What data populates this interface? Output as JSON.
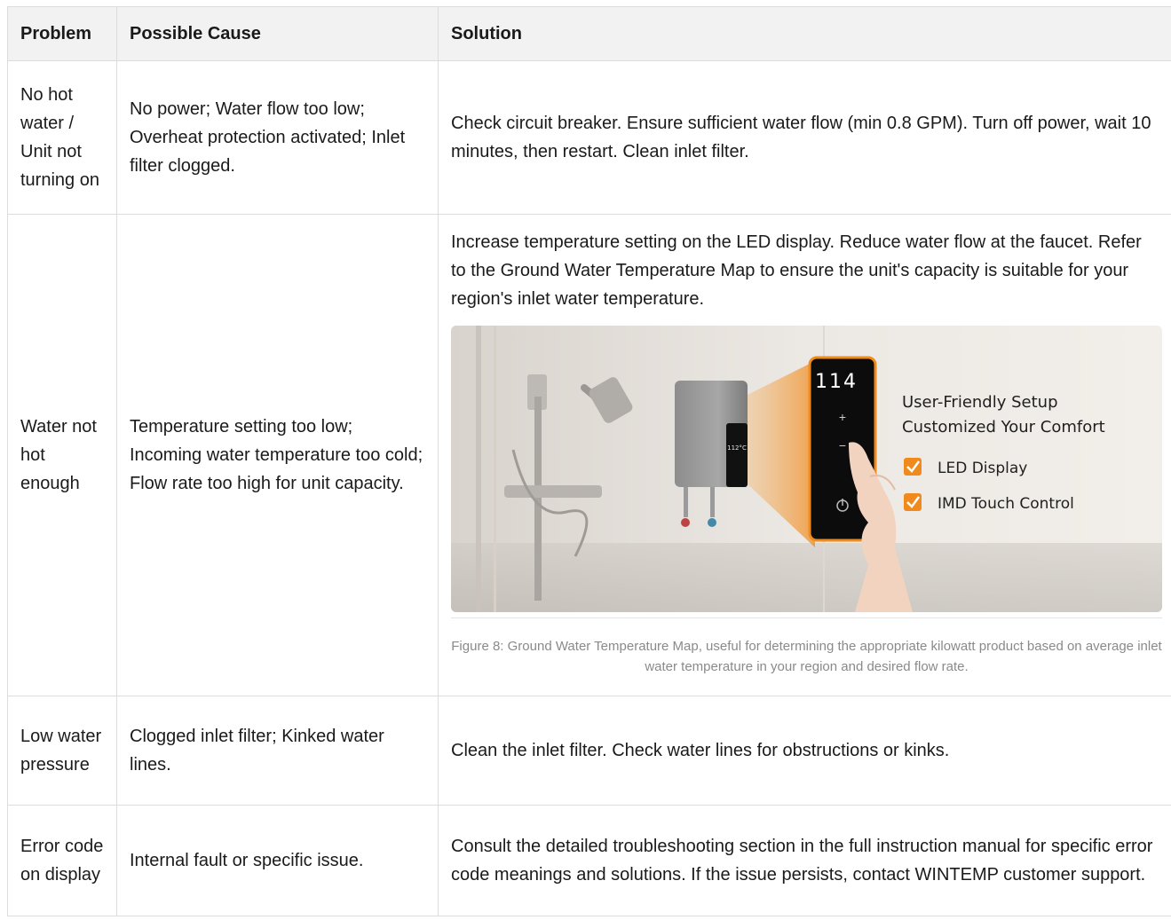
{
  "table": {
    "headers": [
      "Problem",
      "Possible Cause",
      "Solution"
    ],
    "rows": [
      {
        "problem": "No hot water / Unit not turning on",
        "cause": "No power; Water flow too low; Overheat protection activated; Inlet filter clogged.",
        "solution": "Check circuit breaker. Ensure sufficient water flow (min 0.8 GPM). Turn off power, wait 10 minutes, then restart. Clean inlet filter."
      },
      {
        "problem": "Water not hot enough",
        "cause": "Temperature setting too low; Incoming water temperature too cold; Flow rate too high for unit capacity.",
        "solution": "Increase temperature setting on the LED display. Reduce water flow at the faucet. Refer to the Ground Water Temperature Map to ensure the unit's capacity is suitable for your region's inlet water temperature."
      },
      {
        "problem": "Low water pressure",
        "cause": "Clogged inlet filter; Kinked water lines.",
        "solution": "Clean the inlet filter. Check water lines for obstructions or kinks."
      },
      {
        "problem": "Error code on display",
        "cause": "Internal fault or specific issue.",
        "solution": "Consult the detailed troubleshooting section in the full instruction manual for specific error code meanings and solutions. If the issue persists, contact WINTEMP customer support."
      }
    ]
  },
  "figure": {
    "caption": "Figure 8: Ground Water Temperature Map, useful for determining the appropriate kilowatt product based on average inlet water temperature in your region and desired flow rate.",
    "overlay": {
      "heading_line1": "User-Friendly Setup",
      "heading_line2": "Customized Your Comfort",
      "features": [
        "LED Display",
        "IMD Touch Control"
      ],
      "display_temp": "114",
      "unit_display": "112°C"
    }
  },
  "colors": {
    "header_bg": "#f2f2f2",
    "border": "#dcdcdc",
    "accent_orange": "#f08a1c",
    "caption_text": "#8a8a8a"
  }
}
